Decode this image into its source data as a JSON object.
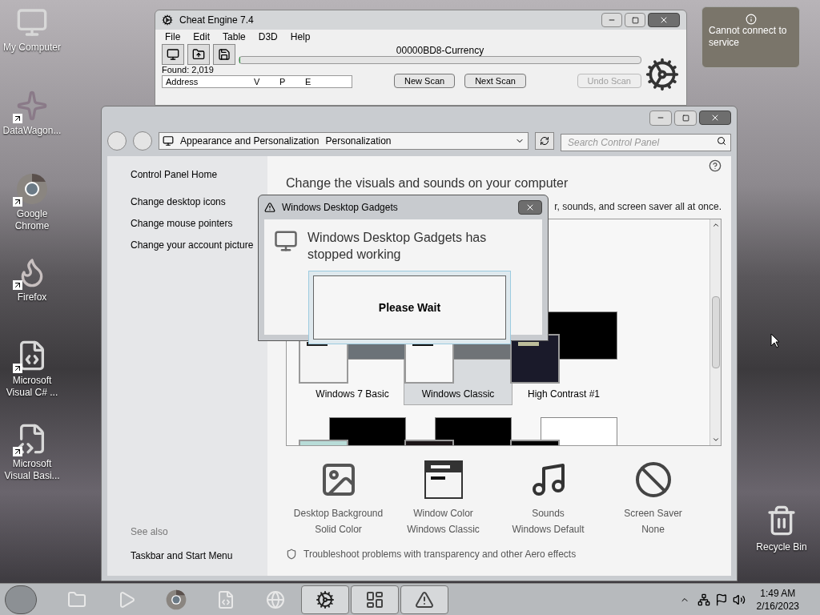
{
  "desktop_icons": [
    {
      "label": "My Computer",
      "kind": "computer",
      "shortcut": false
    },
    {
      "label": "DataWagon...",
      "kind": "star",
      "shortcut": true
    },
    {
      "label": "Google Chrome",
      "kind": "chrome",
      "shortcut": true
    },
    {
      "label": "Firefox",
      "kind": "firefox",
      "shortcut": true
    },
    {
      "label": "Microsoft Visual C# ...",
      "kind": "code",
      "shortcut": true
    },
    {
      "label": "Microsoft Visual Basi...",
      "kind": "code2",
      "shortcut": true
    }
  ],
  "recycle_bin": {
    "label": "Recycle Bin"
  },
  "gadget": {
    "message": "Cannot connect to service"
  },
  "cheat_engine": {
    "title": "Cheat Engine 7.4",
    "menu": [
      "File",
      "Edit",
      "Table",
      "D3D",
      "Help"
    ],
    "process": "00000BD8-Currency",
    "progress": {
      "level": 0.0
    },
    "found": "Found: 2,019",
    "columns": [
      "Address",
      "V",
      "P",
      "E"
    ],
    "buttons": [
      {
        "label": "New Scan",
        "disabled": false
      },
      {
        "label": "Next Scan",
        "disabled": false
      },
      {
        "label": "Undo Scan",
        "disabled": true
      }
    ]
  },
  "control_panel": {
    "breadcrumb": [
      "Appearance and Personalization",
      "Personalization"
    ],
    "search_placeholder": "Search Control Panel",
    "home": "Control Panel Home",
    "sidebar_links": [
      "Change desktop icons",
      "Change mouse pointers",
      "Change your account picture"
    ],
    "see_also": {
      "heading": "See also",
      "links": [
        "Taskbar and Start Menu"
      ]
    },
    "heading": "Change the visuals and sounds on your computer",
    "intro": "r, sounds, and screen saver all at once.",
    "themes": [
      {
        "name": "Windows 7 Basic",
        "kind": "basic",
        "selected": false
      },
      {
        "name": "Windows Classic",
        "kind": "classic",
        "selected": true
      },
      {
        "name": "High Contrast #1",
        "kind": "contrast",
        "selected": false
      },
      {
        "kind": "contrast2",
        "selected": false
      },
      {
        "kind": "black",
        "selected": false
      },
      {
        "kind": "white",
        "selected": false
      }
    ],
    "settings": [
      {
        "title": "Desktop Background",
        "value": "Solid Color",
        "kind": "background"
      },
      {
        "title": "Window Color",
        "value": "Windows Classic",
        "kind": "window"
      },
      {
        "title": "Sounds",
        "value": "Windows Default",
        "kind": "sounds"
      },
      {
        "title": "Screen Saver",
        "value": "None",
        "kind": "screensaver"
      }
    ],
    "troubleshoot": "Troubleshoot problems with transparency and other Aero effects"
  },
  "error_dialog": {
    "title": "Windows Desktop Gadgets",
    "message": "Windows Desktop Gadgets has stopped working"
  },
  "wait_box": {
    "text": "Please Wait"
  },
  "taskbar": {
    "items": [
      {
        "kind": "explorer",
        "active": false
      },
      {
        "kind": "media",
        "active": false
      },
      {
        "kind": "chrome",
        "active": false
      },
      {
        "kind": "code",
        "active": false
      },
      {
        "kind": "ie",
        "active": false
      },
      {
        "kind": "cheat",
        "active": true
      },
      {
        "kind": "control",
        "active": true
      },
      {
        "kind": "gadget",
        "active": true
      }
    ],
    "clock": {
      "time": "1:49 AM",
      "date": "2/16/2023"
    }
  }
}
